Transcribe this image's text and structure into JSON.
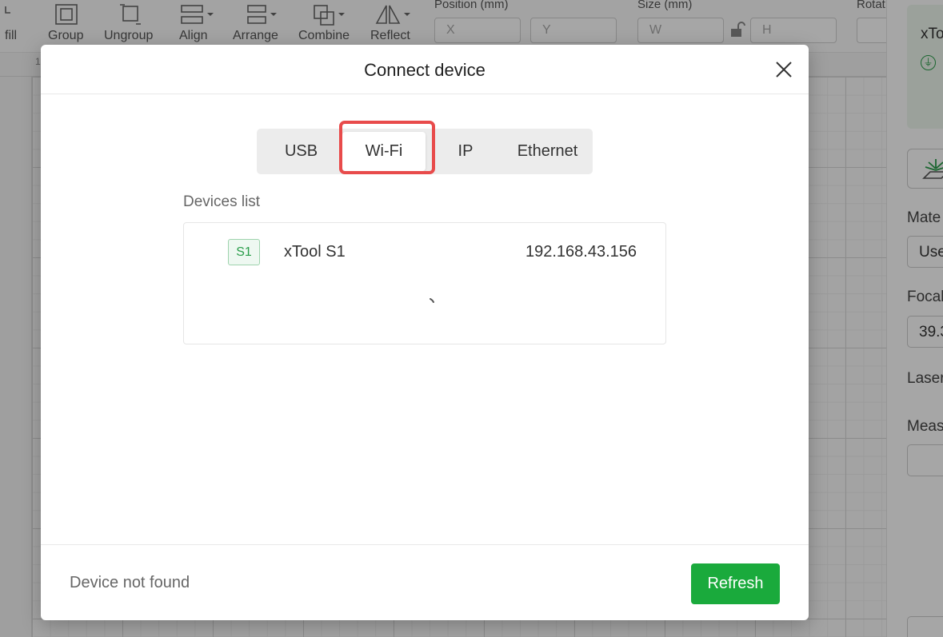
{
  "toolbar": {
    "fill_label": "fill",
    "group_label": "Group",
    "ungroup_label": "Ungroup",
    "align_label": "Align",
    "arrange_label": "Arrange",
    "combine_label": "Combine",
    "reflect_label": "Reflect",
    "position_label": "Position (mm)",
    "position_x_placeholder": "X",
    "position_y_placeholder": "Y",
    "size_label": "Size (mm)",
    "size_w_placeholder": "W",
    "size_h_placeholder": "H",
    "rotate_label": "Rotat"
  },
  "ruler": {
    "top_tick": "1"
  },
  "right_panel": {
    "device_name": "xTo",
    "material_label": "Mate",
    "material_value": "Use",
    "focal_label": "Focal",
    "focal_value": "39.3",
    "laser_label": "Laser",
    "measure_label": "Meas"
  },
  "modal": {
    "title": "Connect device",
    "tabs": [
      {
        "label": "USB"
      },
      {
        "label": "Wi-Fi"
      },
      {
        "label": "IP"
      },
      {
        "label": "Ethernet"
      }
    ],
    "active_tab": "Wi-Fi",
    "devices_list_label": "Devices list",
    "devices": [
      {
        "badge": "S1",
        "name": "xTool S1",
        "ip": "192.168.43.156"
      }
    ],
    "status_text": "Device not found",
    "refresh_label": "Refresh"
  },
  "colors": {
    "accent_green": "#1aaa3c",
    "highlight_red": "#e84b4b",
    "badge_green": "#2a9d4a"
  },
  "icons": [
    "group-icon",
    "ungroup-icon",
    "align-icon",
    "arrange-icon",
    "combine-icon",
    "reflect-icon",
    "lock-icon",
    "close-icon",
    "loading-spinner-icon",
    "plug-icon",
    "laser-icon"
  ]
}
